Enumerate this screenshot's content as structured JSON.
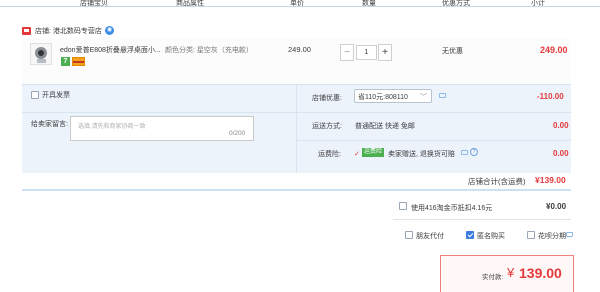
{
  "header": {
    "columns": [
      "店铺宝贝",
      "商品属性",
      "单价",
      "数量",
      "优惠方式",
      "小计"
    ]
  },
  "shop": {
    "name": "店铺: 港北数码专营店"
  },
  "item": {
    "title": "edon爱普E808折叠悬浮桌面小...",
    "tag": "7",
    "attr": "颜色分类: 星空灰（充电款）",
    "price": "249.00",
    "quantity": "1",
    "minus": "−",
    "plus": "+",
    "discount": "无优惠",
    "subtotal": "249.00"
  },
  "options": {
    "invoice_label": "开具发票",
    "message_label": "给卖家留言:",
    "message_placeholder": "选填,请先和商家协商一致",
    "message_count": "0/200",
    "coupon_label": "店铺优惠:",
    "coupon_value": "省110元:808110",
    "coupon_amount": "-110.00",
    "shipping_label": "运送方式:",
    "shipping_value": "普通配送 快递 免邮",
    "shipping_amount": "0.00",
    "insurance_label": "运费险:",
    "insurance_check": "✓",
    "insurance_tag": "运费险",
    "insurance_text": "卖家赠送, 退换货可赔",
    "insurance_amount": "0.00"
  },
  "shop_total": {
    "label": "店铺合计(含运费)",
    "amount": "¥139.00"
  },
  "coins": {
    "text": "使用416淘金币抵扣4.16元",
    "amount": "¥0.00"
  },
  "pay_options": {
    "friend_pay": "朋友代付",
    "anonymous": "匿名购买",
    "huabei": "花呗分期"
  },
  "payment": {
    "label": "实付款:",
    "currency": "¥",
    "amount": "139.00"
  },
  "colors": {
    "price_red": "#e4393c",
    "panel_blue": "#edf3fb",
    "accent_blue": "#3b7cde"
  }
}
